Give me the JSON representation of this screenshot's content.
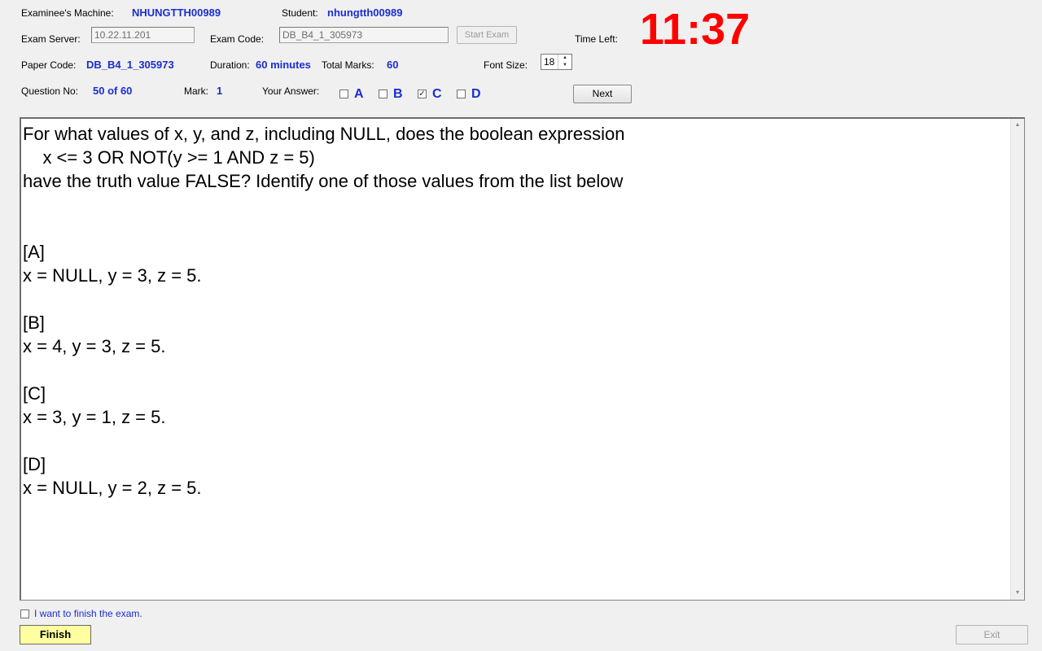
{
  "header": {
    "machine_label": "Examinee's Machine:",
    "machine_value": "NHUNGTTH00989",
    "student_label": "Student:",
    "student_value": "nhungtth00989",
    "server_label": "Exam Server:",
    "server_value": "10.22.11.201",
    "exam_code_label": "Exam Code:",
    "exam_code_value": "DB_B4_1_305973",
    "start_exam_label": "Start Exam",
    "time_left_label": "Time Left:",
    "time_left_value": "11:37",
    "paper_code_label": "Paper Code:",
    "paper_code_value": "DB_B4_1_305973",
    "duration_label": "Duration:",
    "duration_value": "60 minutes",
    "total_marks_label": "Total Marks:",
    "total_marks_value": "60",
    "font_size_label": "Font Size:",
    "font_size_value": "18",
    "question_no_label": "Question No:",
    "question_no_value": "50 of 60",
    "mark_label": "Mark:",
    "mark_value": "1",
    "your_answer_label": "Your Answer:",
    "next_label": "Next"
  },
  "answers": [
    {
      "label": "A",
      "checked": false
    },
    {
      "label": "B",
      "checked": false
    },
    {
      "label": "C",
      "checked": true
    },
    {
      "label": "D",
      "checked": false
    }
  ],
  "question": {
    "text": "For what values of x, y, and z, including NULL, does the boolean expression\n    x <= 3 OR NOT(y >= 1 AND z = 5)\nhave the truth value FALSE? Identify one of those values from the list below\n\n\n[A]\nx = NULL, y = 3, z = 5.\n\n[B]\nx = 4, y = 3, z = 5.\n\n[C]\nx = 3, y = 1, z = 5.\n\n[D]\nx = NULL, y = 2, z = 5."
  },
  "footer": {
    "finish_check_label": "I want to finish the exam.",
    "finish_checked": false,
    "finish_label": "Finish",
    "exit_label": "Exit"
  },
  "colors": {
    "value_blue": "#1a2ed0",
    "timer_red": "#ff0000",
    "finish_yellow": "#ffffa0"
  }
}
